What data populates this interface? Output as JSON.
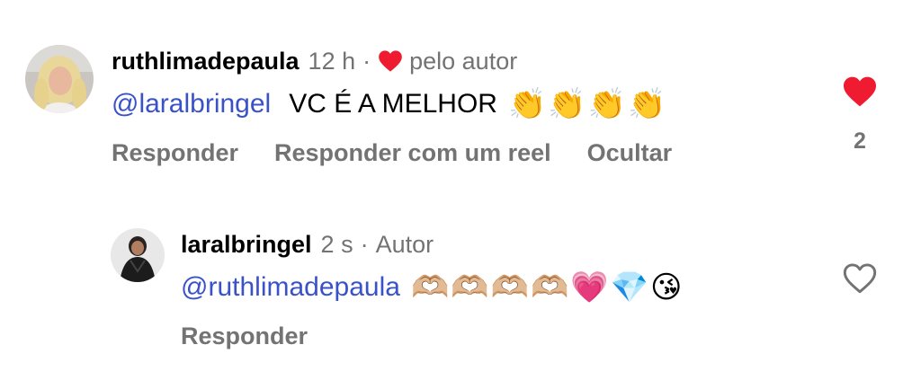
{
  "comments": [
    {
      "username": "ruthlimadepaula",
      "time": "12 h",
      "separator": "·",
      "liked_by_author_label": "pelo autor",
      "mention": "@laralbringel",
      "message": "VC É A MELHOR",
      "emojis": "👏👏👏👏",
      "actions": [
        "Responder",
        "Responder com um reel",
        "Ocultar"
      ],
      "like_count": "2",
      "liked": true
    },
    {
      "username": "laralbringel",
      "time": "2 s",
      "separator": "·",
      "author_label": "Autor",
      "mention": "@ruthlimadepaula",
      "emojis": "🫶🏼🫶🏼🫶🏼🫶🏼💗💎😘",
      "actions": [
        "Responder"
      ],
      "liked": false
    }
  ],
  "colors": {
    "heart_red": "#ef1b30",
    "mention_blue": "#3a52c8",
    "muted_grey": "#737373"
  },
  "icons": {
    "liked": "heart-filled-icon",
    "unliked": "heart-outline-icon"
  }
}
